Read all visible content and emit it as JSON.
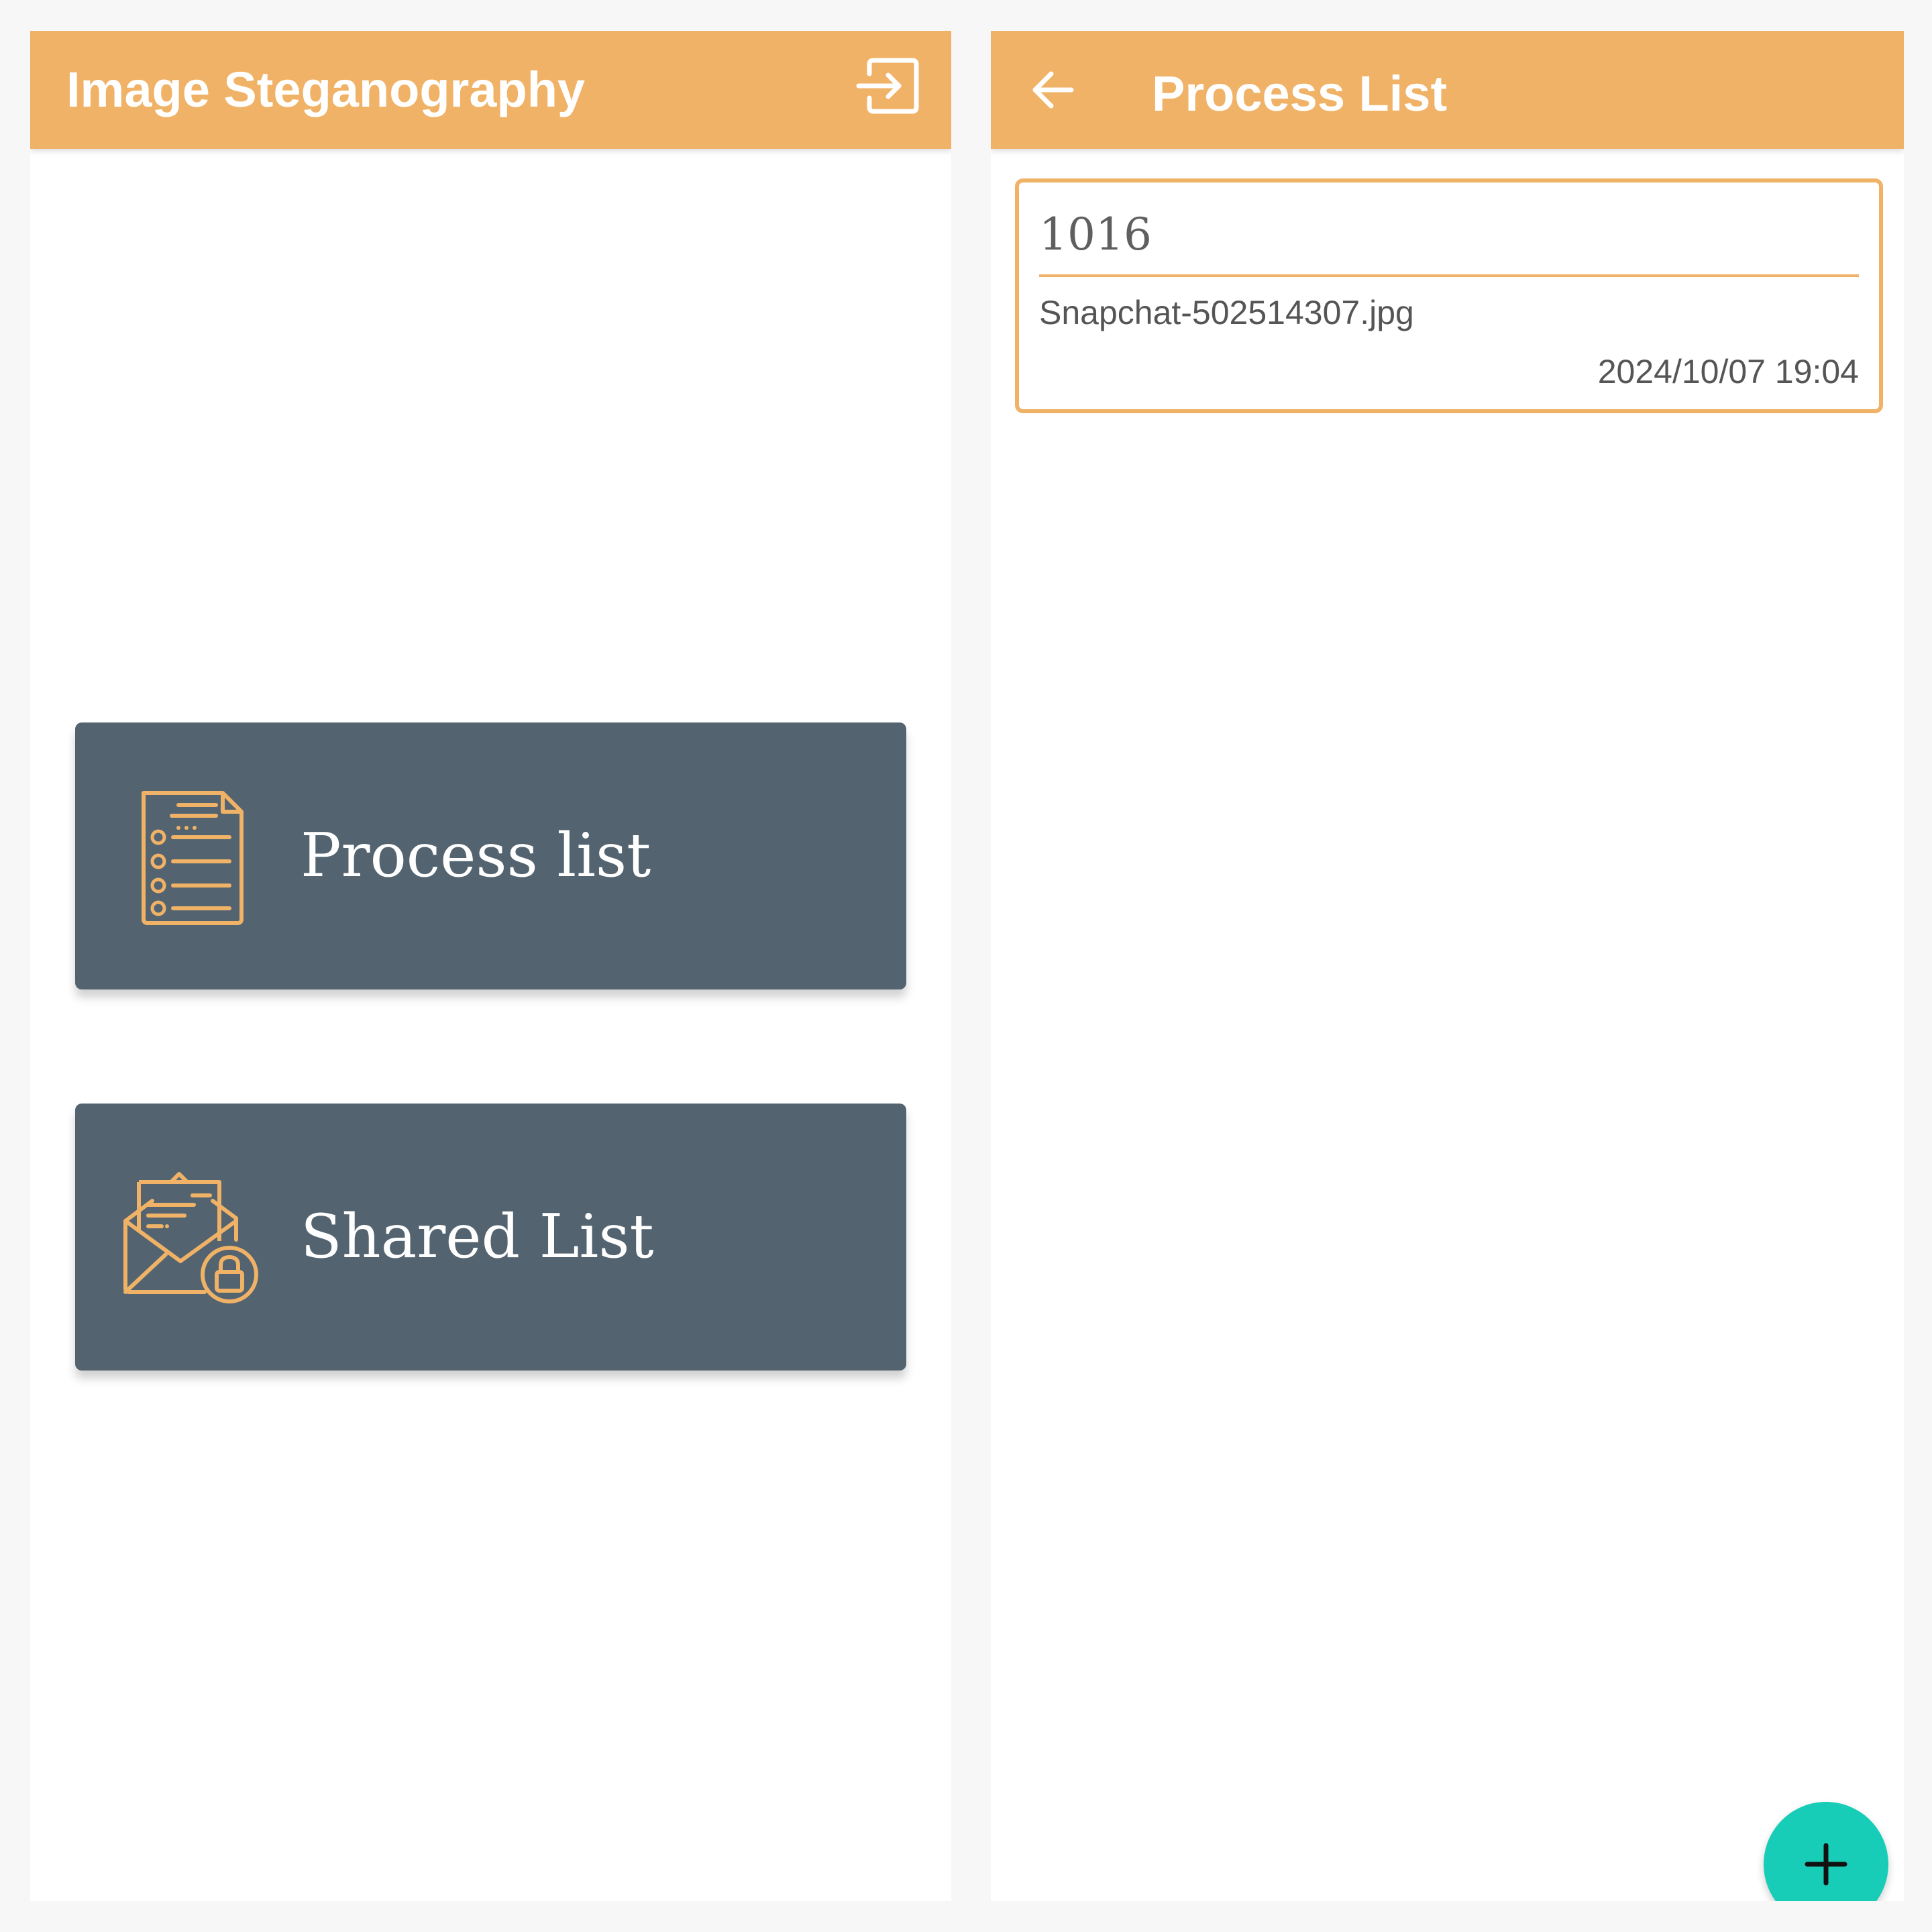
{
  "home_screen": {
    "title": "Image Steganography",
    "logout_icon": "logout-icon",
    "menu": [
      {
        "label": "Process list",
        "icon": "checklist-icon"
      },
      {
        "label": "Shared List",
        "icon": "locked-mail-icon"
      }
    ]
  },
  "process_screen": {
    "title": "Process List",
    "back_icon": "arrow-left-icon",
    "items": [
      {
        "id": "1016",
        "file": "Snapchat-502514307.jpg",
        "date": "2024/10/07 19:04"
      }
    ],
    "fab_icon": "plus-icon"
  },
  "colors": {
    "accent": "#f0b266",
    "card": "#536470",
    "fab": "#17cdb8"
  }
}
